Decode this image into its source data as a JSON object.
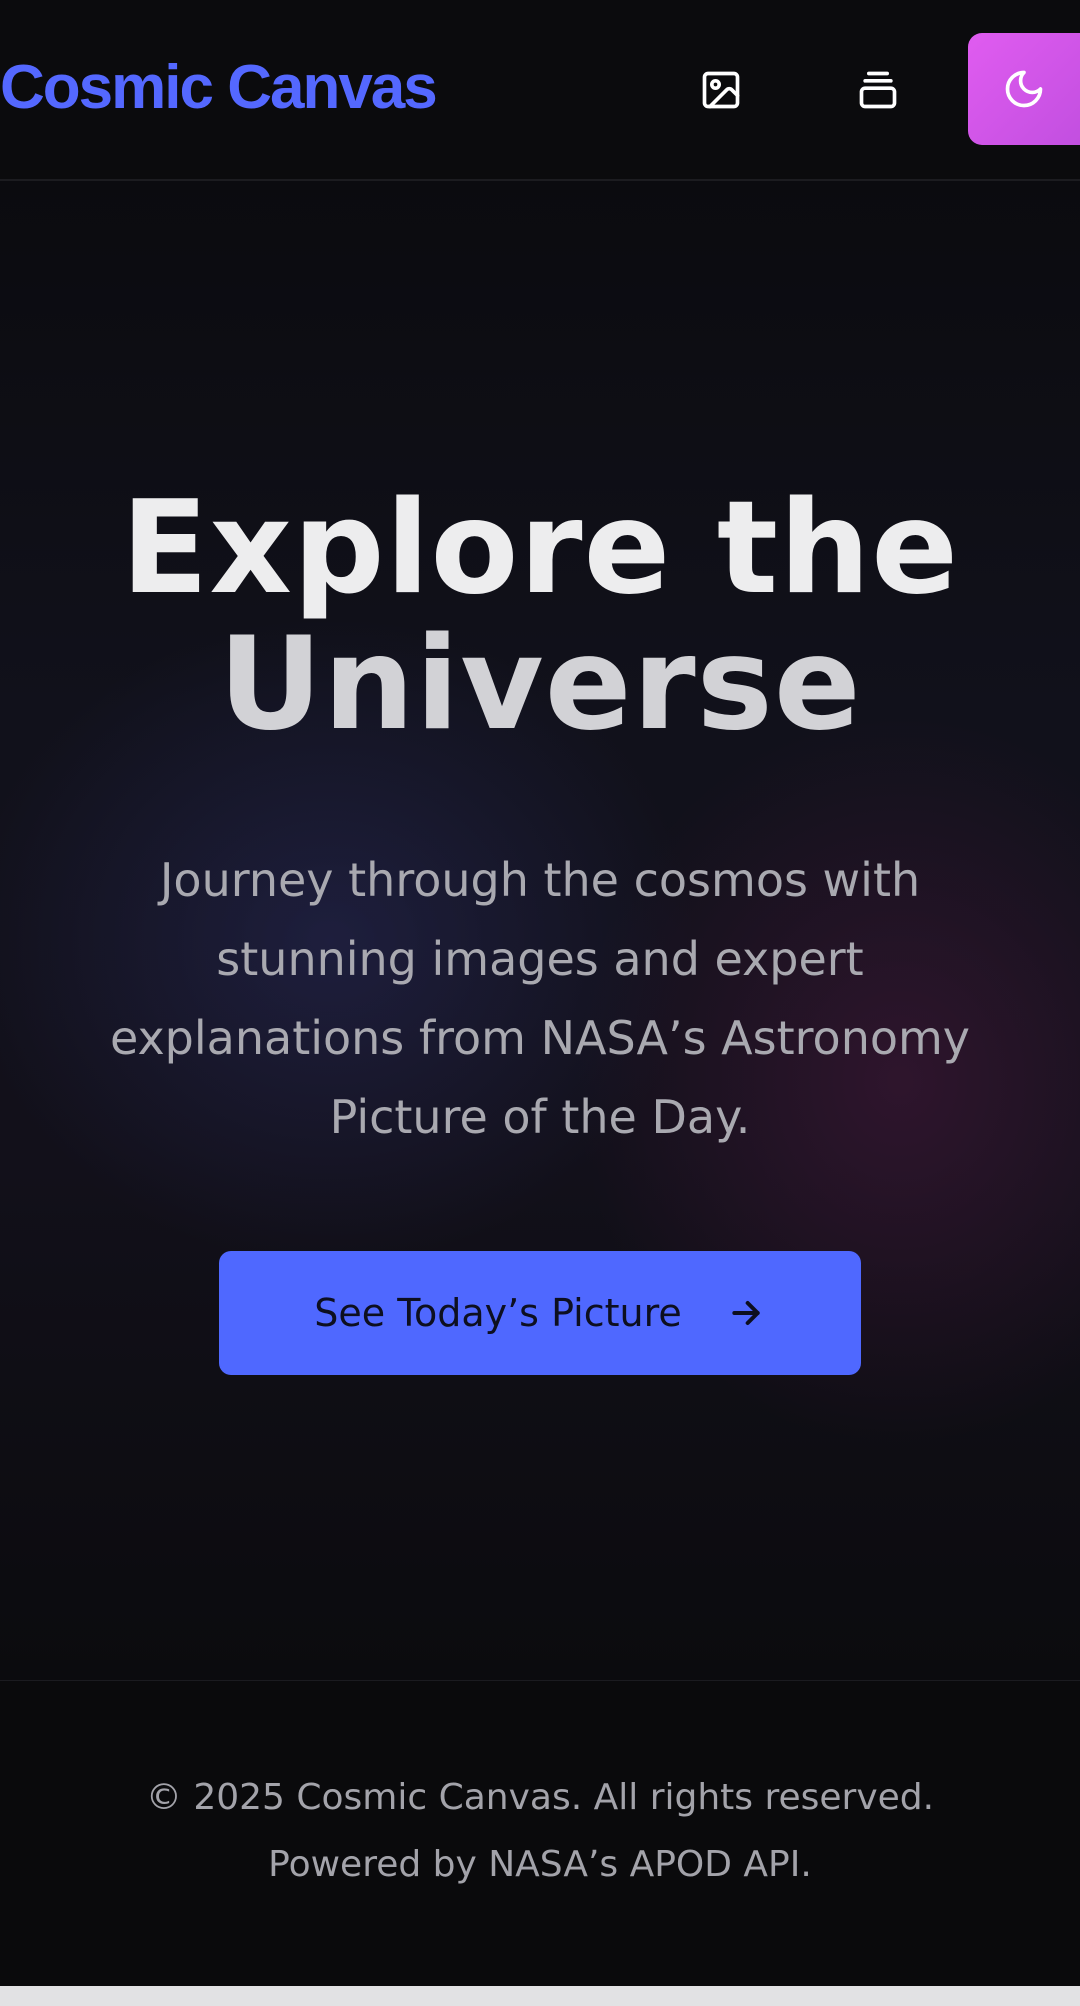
{
  "header": {
    "brand": "Cosmic Canvas",
    "nav": [
      {
        "icon": "image-icon",
        "label": "Gallery"
      },
      {
        "icon": "stack-icon",
        "label": "Collection"
      }
    ],
    "theme_toggle": {
      "icon": "moon-icon"
    }
  },
  "hero": {
    "title_line1": "Explore the",
    "title_line2": "Universe",
    "subtitle": "Journey through the cosmos with stunning images and expert explanations from NASA’s Astronomy Picture of the Day.",
    "cta_label": "See Today’s Picture",
    "cta_icon": "arrow-right-icon"
  },
  "footer": {
    "copyright": "© 2025 Cosmic Canvas. All rights reserved.",
    "powered_by": "Powered by NASA’s APOD API."
  },
  "colors": {
    "brand": "#5468ff",
    "cta_background": "#4f68ff",
    "theme_toggle": "#d656ea",
    "page_background": "#0a0a0c"
  }
}
